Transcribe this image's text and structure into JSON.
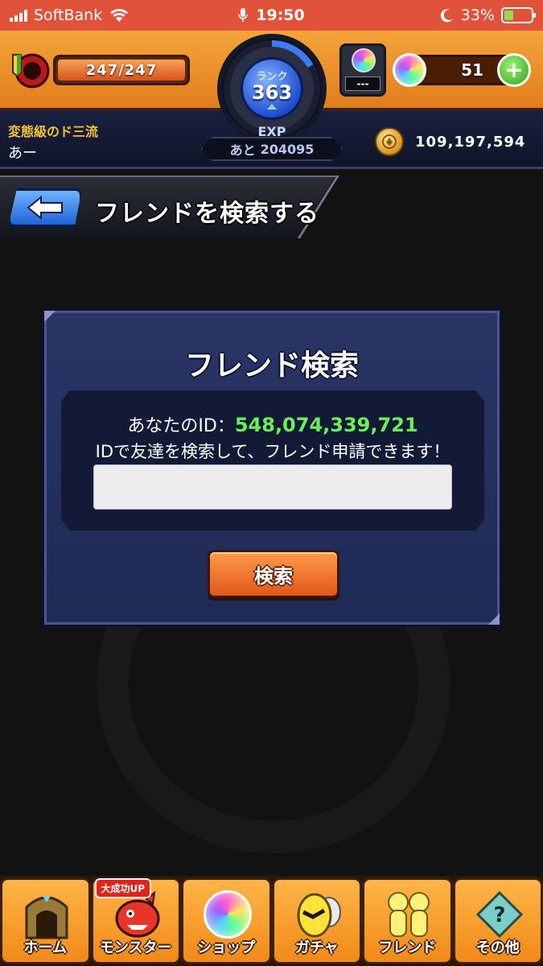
{
  "status_bar": {
    "carrier": "SoftBank",
    "time": "19:50",
    "battery_pct": "33%",
    "battery_level": 0.33
  },
  "header": {
    "stamina": "247/247",
    "rank_label": "ランク",
    "rank": "363",
    "exp_label": "EXP",
    "exp_prefix": "あと",
    "exp_remaining": "204095",
    "item_slot_text": "---",
    "orbs": "51",
    "player_title": "変態級のド三流",
    "player_name": "あー",
    "coins": "109,197,594",
    "colors": {
      "top": "#f4a43a",
      "bottom": "#1a2140",
      "accent_orange": "#e27d1c"
    }
  },
  "page": {
    "title": "フレンドを検索する",
    "back_icon": "back-arrow-icon"
  },
  "dialog": {
    "title": "フレンド検索",
    "id_label": "あなたのID：",
    "id_value": "548,074,339,721",
    "help_text": "IDで友達を検索して、フレンド申請できます！",
    "input_value": "",
    "input_placeholder": "",
    "search_button": "検索",
    "colors": {
      "id_value": "#6cf05a"
    }
  },
  "bottom_nav": {
    "items": [
      {
        "label": "ホーム",
        "icon": "home-gate-icon"
      },
      {
        "label": "モンスター",
        "icon": "monster-icon",
        "badge": "大成功UP"
      },
      {
        "label": "ショップ",
        "icon": "orb-shop-icon"
      },
      {
        "label": "ガチャ",
        "icon": "gacha-egg-icon"
      },
      {
        "label": "フレンド",
        "icon": "friend-icon"
      },
      {
        "label": "その他",
        "icon": "other-menu-icon"
      }
    ]
  }
}
